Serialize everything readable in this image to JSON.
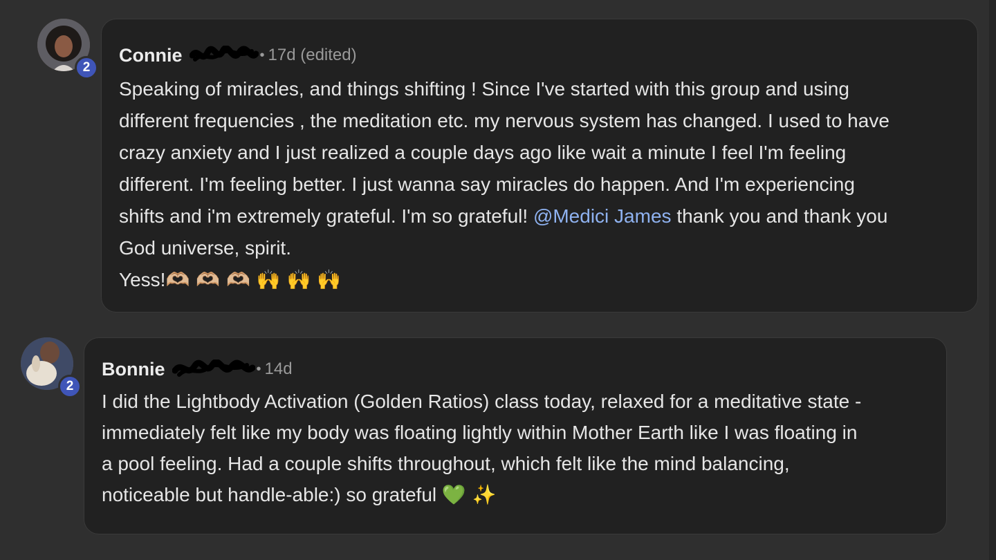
{
  "comments": [
    {
      "author": "Connie",
      "separator": "•",
      "time": "17d (edited)",
      "level": "2",
      "body_lines": [
        "Speaking of miracles, and things shifting ! Since I've started with this group and using",
        "different frequencies , the meditation etc. my nervous system has changed. I used to have",
        "crazy anxiety and I just realized a couple days ago like wait a minute I feel I'm feeling",
        "different. I'm feeling better. I just wanna say miracles do happen. And I'm experiencing"
      ],
      "line5_before": "shifts and i'm extremely grateful. I'm so grateful!",
      "mention": "@Medici James",
      "line5_after": "thank you and thank you",
      "line6": "God universe, spirit.",
      "line7_text": "Yess!",
      "line7_emoji": "🫶🏼 🫶🏼 🫶🏼 🙌 🙌 🙌"
    },
    {
      "author": "Bonnie",
      "separator": "•",
      "time": "14d",
      "level": "2",
      "body_lines": [
        "I did the Lightbody Activation (Golden Ratios) class today, relaxed for a meditative state -",
        "immediately felt like my body was floating lightly within Mother Earth like I was floating in",
        "a pool feeling. Had a couple shifts throughout, which felt like the mind balancing,"
      ],
      "last_line_text": "noticeable but handle-able:) so grateful",
      "last_line_emoji": "💚 ✨"
    }
  ],
  "colors": {
    "page_bg": "#2f2f2f",
    "bubble_bg": "#212121",
    "mention": "#8fb2f0",
    "level_badge": "#3f55b8"
  }
}
